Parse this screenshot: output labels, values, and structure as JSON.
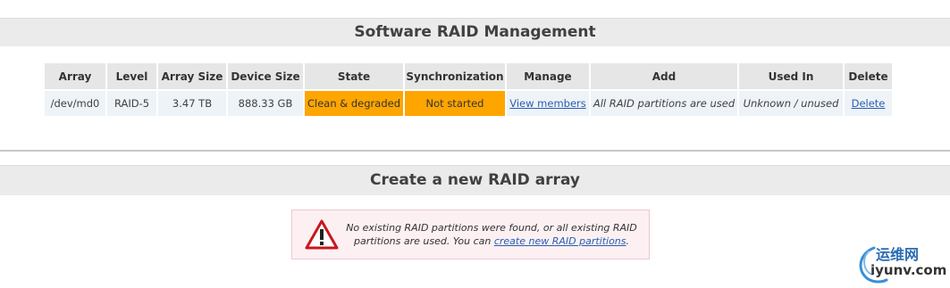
{
  "sections": {
    "management_title": "Software RAID Management",
    "create_title": "Create a new RAID array"
  },
  "table": {
    "headers": [
      "Array",
      "Level",
      "Array Size",
      "Device Size",
      "State",
      "Synchronization",
      "Manage",
      "Add",
      "Used In",
      "Delete"
    ],
    "rows": [
      {
        "array": "/dev/md0",
        "level": "RAID-5",
        "array_size": "3.47 TB",
        "device_size": "888.33 GB",
        "state": "Clean & degraded",
        "synchronization": "Not started",
        "manage": "View members",
        "add": "All RAID partitions are used",
        "used_in": "Unknown / unused",
        "delete": "Delete"
      }
    ]
  },
  "notice": {
    "icon": "warning-icon",
    "text_before": "No existing RAID partitions were found, or all existing RAID partitions are used. You can ",
    "link_text": "create new RAID partitions",
    "text_after": "."
  },
  "colors": {
    "warning_cell": "#ffa500",
    "link": "#2a5db0",
    "header_bg": "#ebebeb",
    "notice_bg": "#fcf0f2",
    "notice_border": "#f0c7cf",
    "warning_icon_red": "#c8171e"
  },
  "watermark": {
    "cn": "运维网",
    "en": "iyunv.com"
  }
}
